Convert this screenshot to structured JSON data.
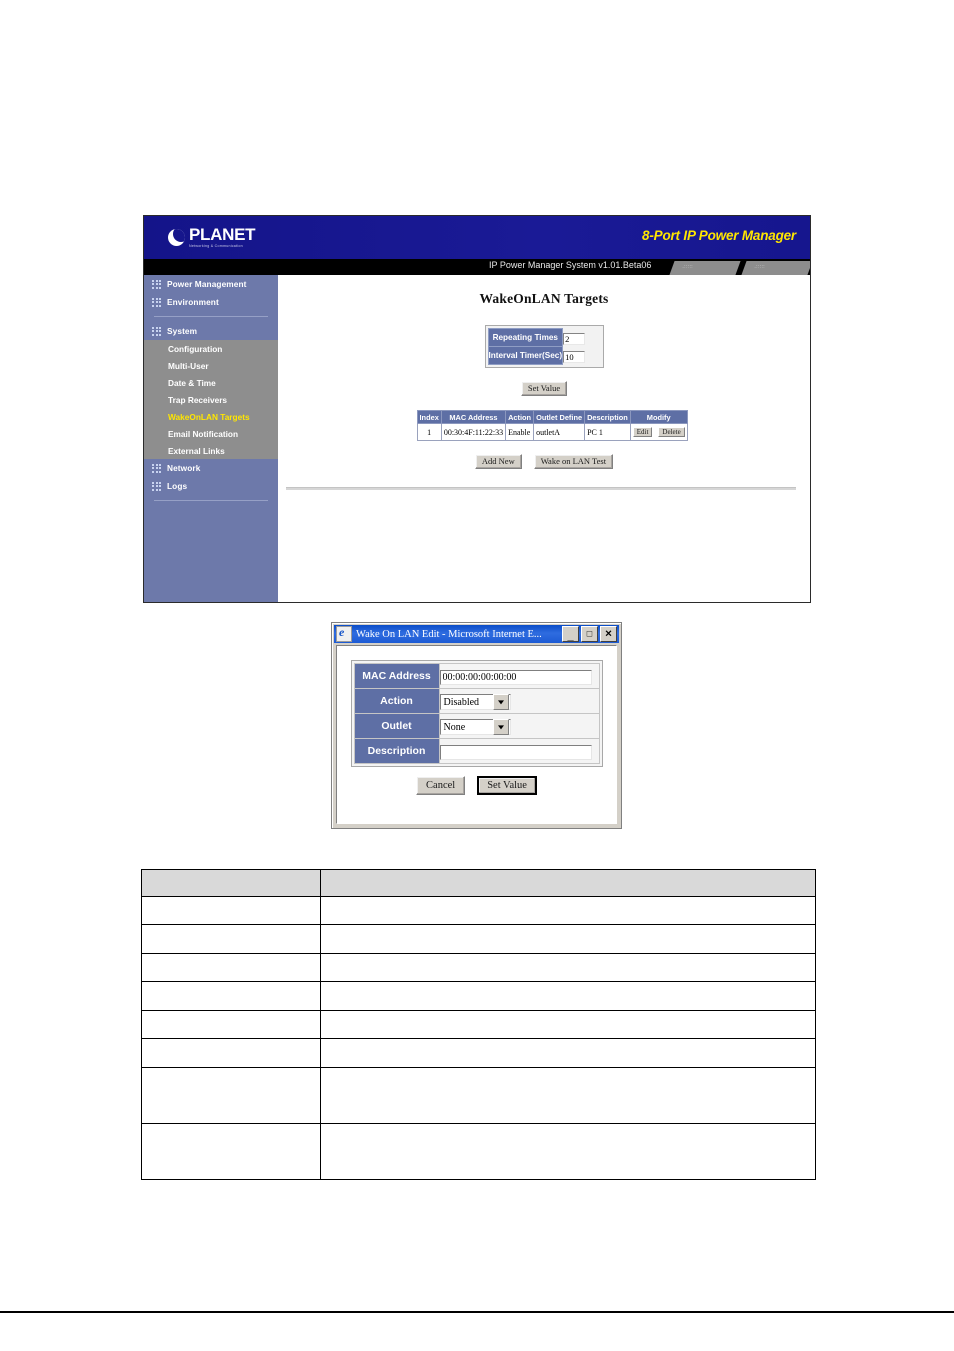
{
  "webui": {
    "banner": {
      "logo_name": "PLANET",
      "logo_tagline": "Networking & Communication",
      "product_title": "8-Port IP Power Manager"
    },
    "subbar": {
      "system_version": "IP Power Manager System v1.01.Beta06",
      "tab1_label": ".:::::",
      "tab2_label": ".:::::"
    },
    "sidebar": {
      "items": [
        {
          "label": "Power Management",
          "type": "top"
        },
        {
          "label": "Environment",
          "type": "top"
        },
        {
          "label": "System",
          "type": "top"
        }
      ],
      "system_submenu": [
        {
          "label": "Configuration",
          "active": false
        },
        {
          "label": "Multi-User",
          "active": false
        },
        {
          "label": "Date & Time",
          "active": false
        },
        {
          "label": "Trap Receivers",
          "active": false
        },
        {
          "label": "WakeOnLAN Targets",
          "active": true
        },
        {
          "label": "Email Notification",
          "active": false
        },
        {
          "label": "External Links",
          "active": false
        }
      ],
      "items_after": [
        {
          "label": "Network",
          "type": "top"
        },
        {
          "label": "Logs",
          "type": "top"
        }
      ]
    },
    "content": {
      "page_title": "WakeOnLAN Targets",
      "settings": {
        "repeating_times_label": "Repeating Times",
        "repeating_times_value": "2",
        "interval_timer_label": "Interval Timer(Sec)",
        "interval_timer_value": "10",
        "set_value_label": "Set Value"
      },
      "table": {
        "columns": [
          "Index",
          "MAC Address",
          "Action",
          "Outlet Define",
          "Description",
          "Modify"
        ],
        "rows": [
          {
            "index": "1",
            "mac_address": "00:30:4F:11:22:33",
            "action": "Enable",
            "outlet_define": "outletA",
            "description": "PC 1",
            "edit_label": "Edit",
            "delete_label": "Delete"
          }
        ]
      },
      "actions": {
        "add_new_label": "Add New",
        "wol_test_label": "Wake on LAN Test"
      }
    }
  },
  "dialog": {
    "title": "Wake On LAN Edit - Microsoft Internet E...",
    "window_buttons": {
      "minimize": "_",
      "maximize": "□",
      "close": "✕"
    },
    "fields": [
      {
        "label": "MAC Address",
        "kind": "text",
        "value": "00:00:00:00:00:00"
      },
      {
        "label": "Action",
        "kind": "select",
        "value": "Disabled"
      },
      {
        "label": "Outlet",
        "kind": "select",
        "value": "None"
      },
      {
        "label": "Description",
        "kind": "text",
        "value": ""
      }
    ],
    "buttons": {
      "cancel": "Cancel",
      "set_value": "Set Value"
    }
  },
  "spec_table": {
    "rows": 9,
    "header_cells": [
      "",
      ""
    ],
    "body_cells": [
      [
        "",
        ""
      ],
      [
        "",
        ""
      ],
      [
        "",
        ""
      ],
      [
        "",
        ""
      ],
      [
        "",
        ""
      ],
      [
        "",
        ""
      ],
      [
        "",
        ""
      ],
      [
        "",
        ""
      ]
    ]
  },
  "colors": {
    "banner_blue": "#16168c",
    "sidebar_blue": "#6d79aa",
    "submenu_gray": "#8e8e8e",
    "accent_yellow": "#ffe600",
    "table_header_blue": "#5e6fa5",
    "dialog_face": "#d4d0c8"
  }
}
